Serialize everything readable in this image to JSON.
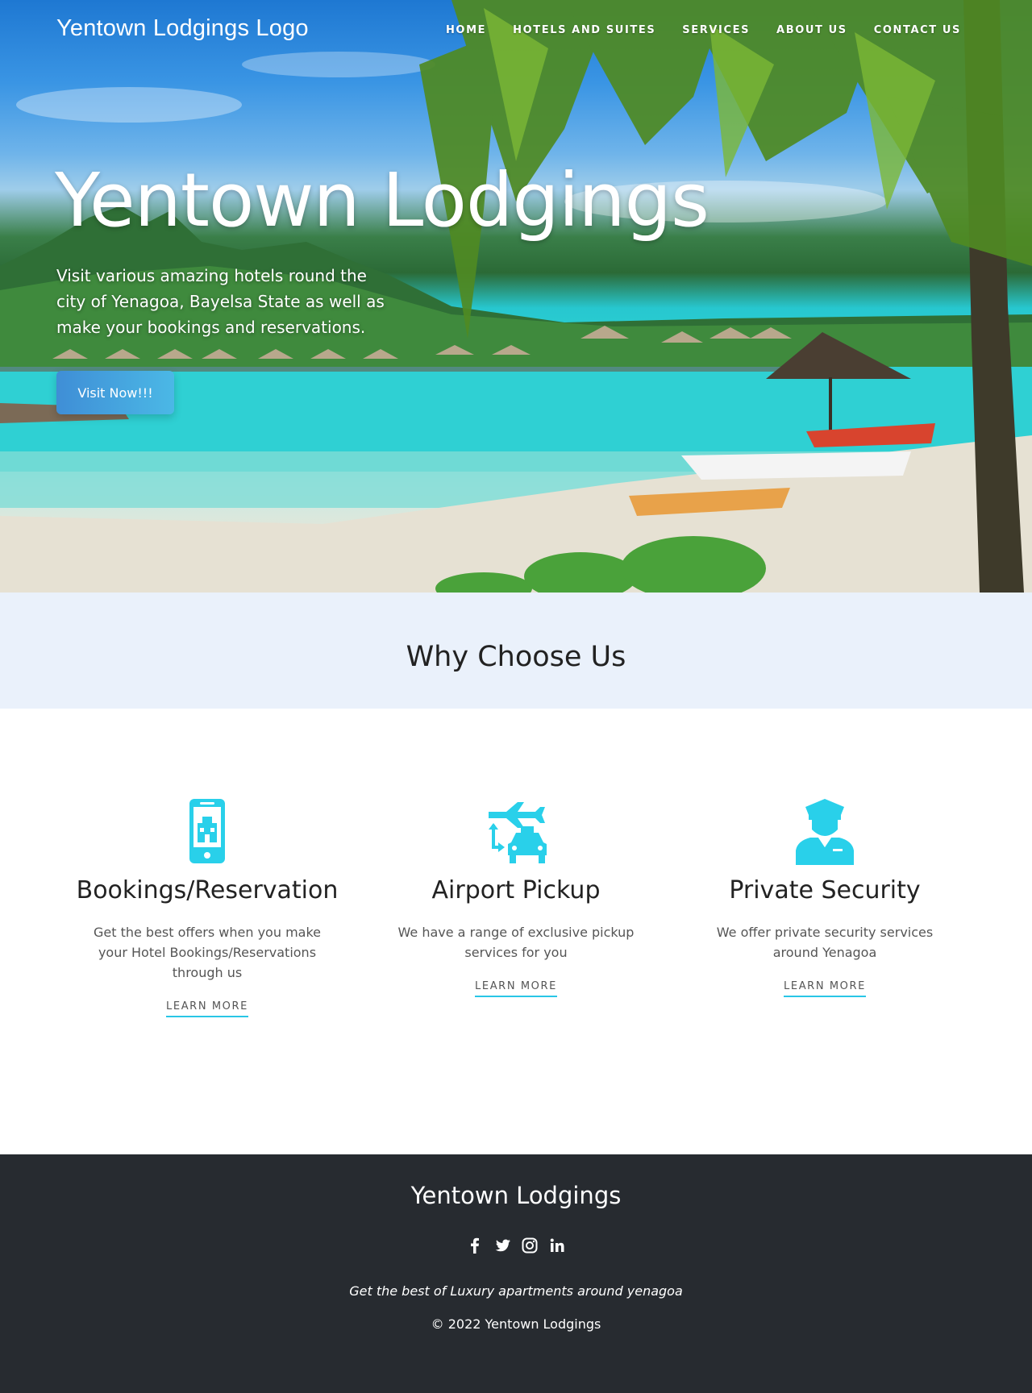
{
  "header": {
    "logo_text": "Yentown Lodgings Logo",
    "nav": [
      "HOME",
      "HOTELS AND SUITES",
      "SERVICES",
      "ABOUT US",
      "CONTACT US"
    ]
  },
  "hero": {
    "title": "Yentown Lodgings",
    "subtitle": "Visit various amazing hotels round the city of Yenagoa, Bayelsa State as well as make your bookings and reservations.",
    "cta_label": "Visit Now!!!"
  },
  "why": {
    "heading": "Why Choose Us",
    "features": [
      {
        "icon": "mobile-hotel-icon",
        "title": "Bookings/Reservation",
        "text": "Get the best offers when you make your Hotel Bookings/Reservations through us",
        "link": "LEARN MORE"
      },
      {
        "icon": "plane-car-icon",
        "title": "Airport Pickup",
        "text": "We have a range of exclusive pickup services for you",
        "link": "LEARN MORE"
      },
      {
        "icon": "security-guard-icon",
        "title": "Private Security",
        "text": "We offer private security services around Yenagoa",
        "link": "LEARN MORE"
      }
    ]
  },
  "footer": {
    "title": "Yentown Lodgings",
    "social": [
      "facebook-icon",
      "twitter-icon",
      "instagram-icon",
      "linkedin-icon"
    ],
    "tagline": "Get the best of Luxury apartments around yenagoa",
    "copyright": "© 2022 Yentown Lodgings"
  },
  "colors": {
    "accent": "#29c6e6",
    "footer_bg": "#272b30",
    "band_bg": "#eaf1fb"
  }
}
